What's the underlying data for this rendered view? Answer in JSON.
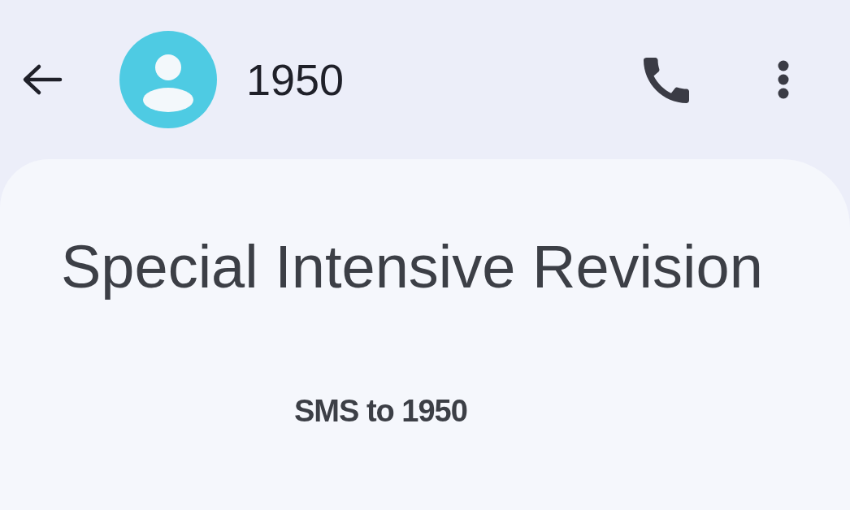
{
  "app_bar": {
    "title": "1950"
  },
  "message": {
    "heading": "Special Intensive Revision",
    "caption": "SMS to 1950"
  }
}
